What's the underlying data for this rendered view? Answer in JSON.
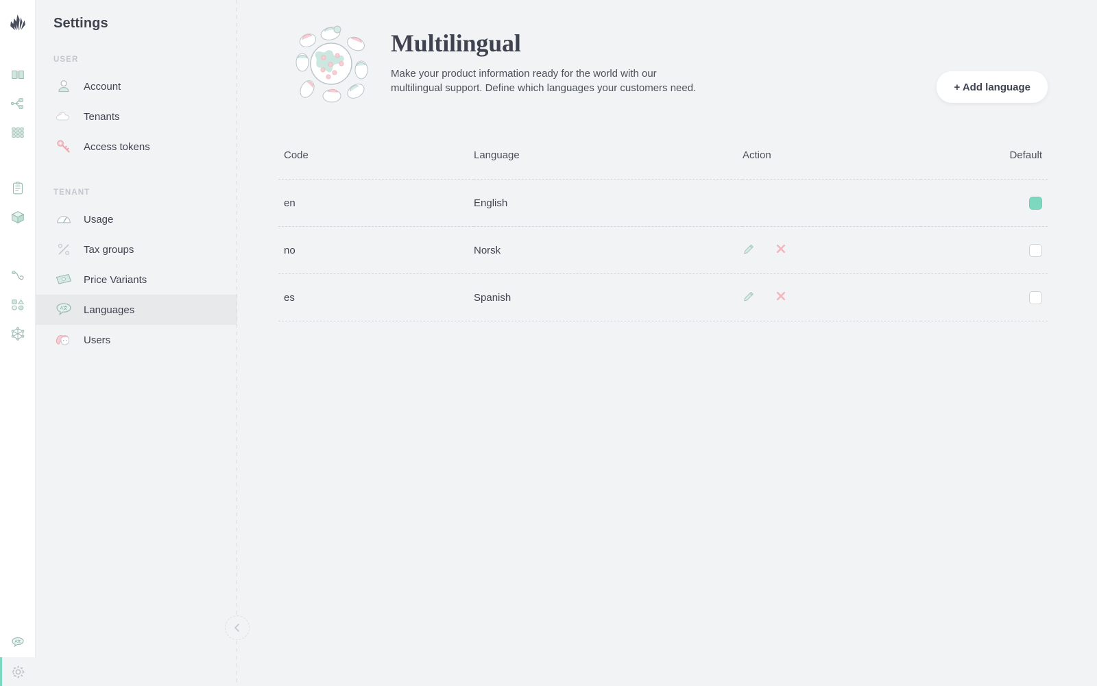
{
  "brand": {
    "logo_icon": "crystallize-logo-icon",
    "accent": "#7cd9c0"
  },
  "rail": {
    "items": [
      {
        "icon": "book-icon",
        "name": "rail-item-catalogue"
      },
      {
        "icon": "sitemap-icon",
        "name": "rail-item-topics"
      },
      {
        "icon": "grid-icon",
        "name": "rail-item-grids"
      },
      {
        "icon": "document-icon",
        "name": "rail-item-documents"
      },
      {
        "icon": "box-icon",
        "name": "rail-item-products"
      },
      {
        "icon": "hook-icon",
        "name": "rail-item-webhooks"
      },
      {
        "icon": "shapes-icon",
        "name": "rail-item-shapes"
      },
      {
        "icon": "graphql-icon",
        "name": "rail-item-graphql"
      }
    ],
    "bottom": [
      {
        "icon": "language-bubble-icon",
        "name": "rail-item-language",
        "active": false
      },
      {
        "icon": "gear-icon",
        "name": "rail-item-settings",
        "active": true
      }
    ]
  },
  "sidebar": {
    "title": "Settings",
    "sections": [
      {
        "label": "USER",
        "items": [
          {
            "label": "Account",
            "icon": "person-icon"
          },
          {
            "label": "Tenants",
            "icon": "cloud-icon"
          },
          {
            "label": "Access tokens",
            "icon": "key-icon"
          }
        ]
      },
      {
        "label": "TENANT",
        "items": [
          {
            "label": "Usage",
            "icon": "gauge-icon"
          },
          {
            "label": "Tax groups",
            "icon": "percent-icon"
          },
          {
            "label": "Price Variants",
            "icon": "banknote-icon"
          },
          {
            "label": "Languages",
            "icon": "language-bubble-icon"
          },
          {
            "label": "Users",
            "icon": "users-icon"
          }
        ]
      }
    ],
    "active_item": "Languages",
    "collapse_icon": "chevron-left-icon"
  },
  "header": {
    "title": "Multilingual",
    "description": "Make your product information ready for the world with our multilingual support. Define which languages your customers need.",
    "illustration": "globe-with-people-icon",
    "add_button": "+ Add language"
  },
  "table": {
    "columns": [
      "Code",
      "Language",
      "Action",
      "Default"
    ],
    "rows": [
      {
        "code": "en",
        "language": "English",
        "actions": [],
        "default": true
      },
      {
        "code": "no",
        "language": "Norsk",
        "actions": [
          "edit-icon",
          "delete-icon"
        ],
        "default": false
      },
      {
        "code": "es",
        "language": "Spanish",
        "actions": [
          "edit-icon",
          "delete-icon"
        ],
        "default": false
      }
    ]
  }
}
